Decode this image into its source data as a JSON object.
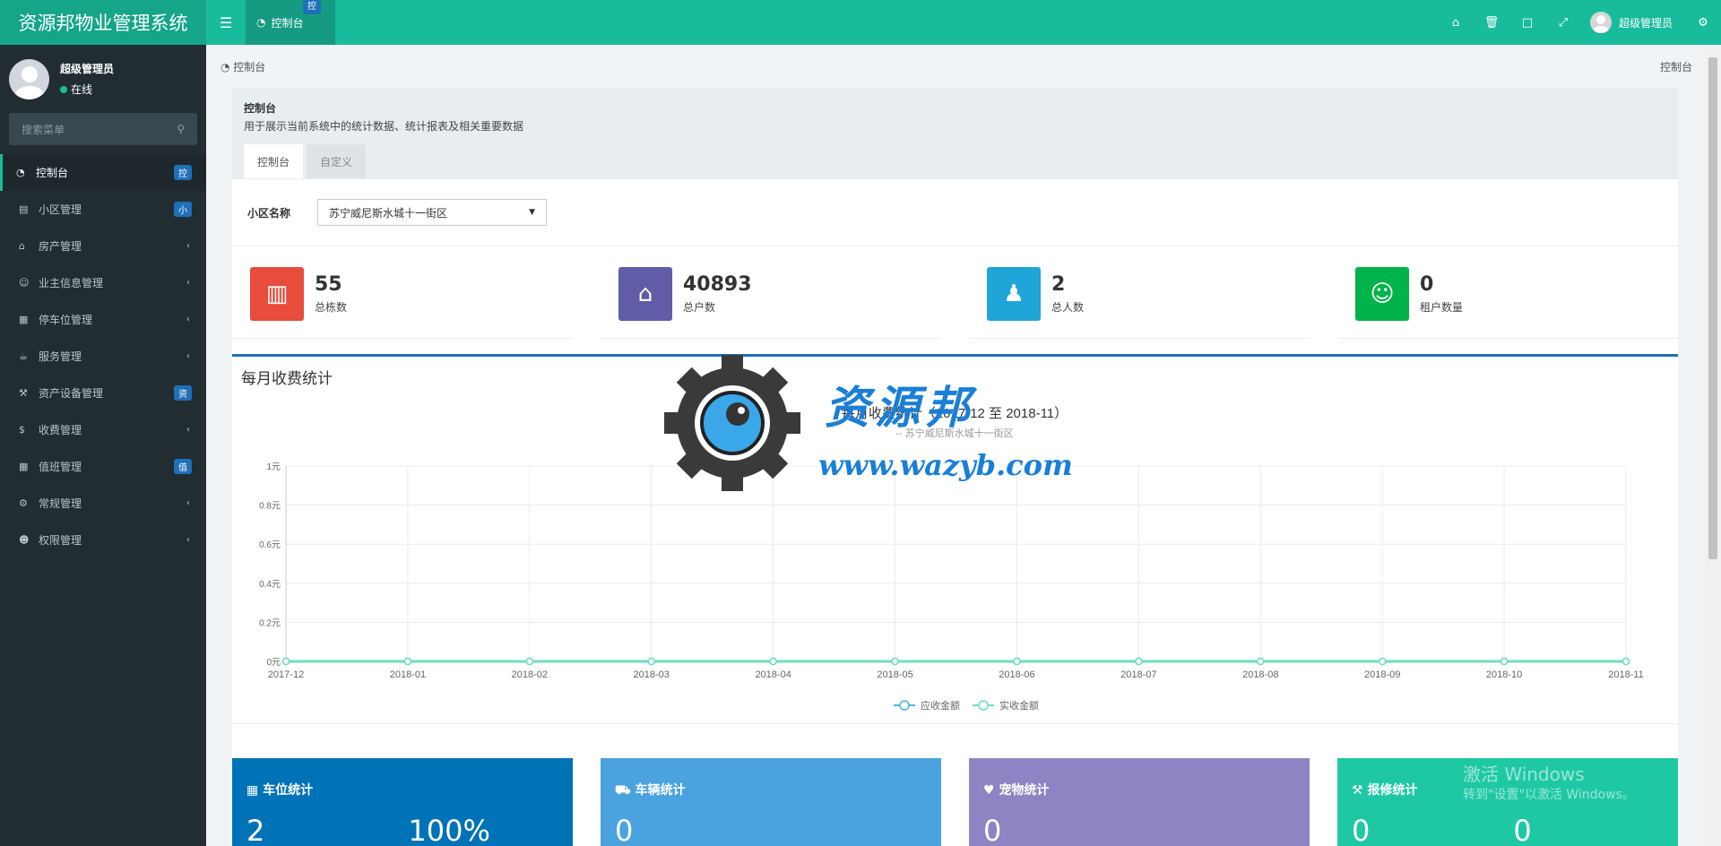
{
  "header": {
    "app_title": "资源邦物业管理系统",
    "tab_label": "控制台",
    "tab_badge": "控",
    "user_name": "超级管理员",
    "icons": [
      "home-icon",
      "trash-icon",
      "translate-icon",
      "fullscreen-icon",
      "gears-icon"
    ]
  },
  "sidebar": {
    "user_name": "超级管理员",
    "status": "在线",
    "search_placeholder": "搜索菜单",
    "items": [
      {
        "label": "控制台",
        "badge": "控",
        "icon": "dashboard-icon"
      },
      {
        "label": "小区管理",
        "badge": "小",
        "icon": "table-icon"
      },
      {
        "label": "房产管理",
        "badge": "",
        "icon": "home-icon"
      },
      {
        "label": "业主信息管理",
        "badge": "",
        "icon": "user-icon"
      },
      {
        "label": "停车位管理",
        "badge": "",
        "icon": "film-icon"
      },
      {
        "label": "服务管理",
        "badge": "",
        "icon": "coffee-icon"
      },
      {
        "label": "资产设备管理",
        "badge": "资",
        "icon": "gavel-icon"
      },
      {
        "label": "收费管理",
        "badge": "",
        "icon": "dollar-icon"
      },
      {
        "label": "值班管理",
        "badge": "值",
        "icon": "calendar-icon"
      },
      {
        "label": "常规管理",
        "badge": "",
        "icon": "cogs-icon"
      },
      {
        "label": "权限管理",
        "badge": "",
        "icon": "group-icon"
      }
    ]
  },
  "breadcrumb": {
    "left": "控制台",
    "right": "控制台"
  },
  "panel": {
    "title": "控制台",
    "description": "用于展示当前系统中的统计数据、统计报表及相关重要数据",
    "tabs": [
      "控制台",
      "自定义"
    ]
  },
  "filter": {
    "label": "小区名称",
    "value": "苏宁威尼斯水城十一街区"
  },
  "stats": [
    {
      "value": "55",
      "label": "总栋数",
      "color": "#e74c3c",
      "icon": "building-icon"
    },
    {
      "value": "40893",
      "label": "总户数",
      "color": "#605ca8",
      "icon": "home-icon"
    },
    {
      "value": "2",
      "label": "总人数",
      "color": "#1fa5d8",
      "icon": "male-icon"
    },
    {
      "value": "0",
      "label": "租户数量",
      "color": "#00b34a",
      "icon": "user-icon"
    }
  ],
  "chart_box_title": "每月收费统计",
  "chart_data": {
    "type": "line",
    "title": "每月收费统计（2017-12 至 2018-11）",
    "subtitle": "-- 苏宁威尼斯水城十一街区",
    "categories": [
      "2017-12",
      "2018-01",
      "2018-02",
      "2018-03",
      "2018-04",
      "2018-05",
      "2018-06",
      "2018-07",
      "2018-08",
      "2018-09",
      "2018-10",
      "2018-11"
    ],
    "y_ticks": [
      "0元",
      "0.2元",
      "0.4元",
      "0.6元",
      "0.8元",
      "1元"
    ],
    "ylim": [
      0,
      1
    ],
    "series": [
      {
        "name": "应收金额",
        "values": [
          0,
          0,
          0,
          0,
          0,
          0,
          0,
          0,
          0,
          0,
          0,
          0
        ],
        "color": "#4ab8d8"
      },
      {
        "name": "实收金额",
        "values": [
          0,
          0,
          0,
          0,
          0,
          0,
          0,
          0,
          0,
          0,
          0,
          0
        ],
        "color": "#6fdcbf"
      }
    ],
    "legend": "bottom-center",
    "grid": true
  },
  "bottom_cards": [
    {
      "title": "车位统计",
      "values": [
        "2",
        "100%"
      ],
      "color": "#0073b7",
      "icon": "film-icon"
    },
    {
      "title": "车辆统计",
      "values": [
        "0",
        ""
      ],
      "color": "#4aa3df",
      "icon": "truck-icon"
    },
    {
      "title": "宠物统计",
      "values": [
        "0",
        ""
      ],
      "color": "#8e84c4",
      "icon": "heart-icon"
    },
    {
      "title": "报修统计",
      "values": [
        "0",
        "0"
      ],
      "color": "#1fc8a5",
      "icon": "wrench-icon"
    }
  ],
  "watermark": {
    "cn": "资源邦",
    "url": "www.wazyb.com"
  },
  "windows_activation": {
    "line1": "激活 Windows",
    "line2": "转到\"设置\"以激活 Windows。"
  }
}
